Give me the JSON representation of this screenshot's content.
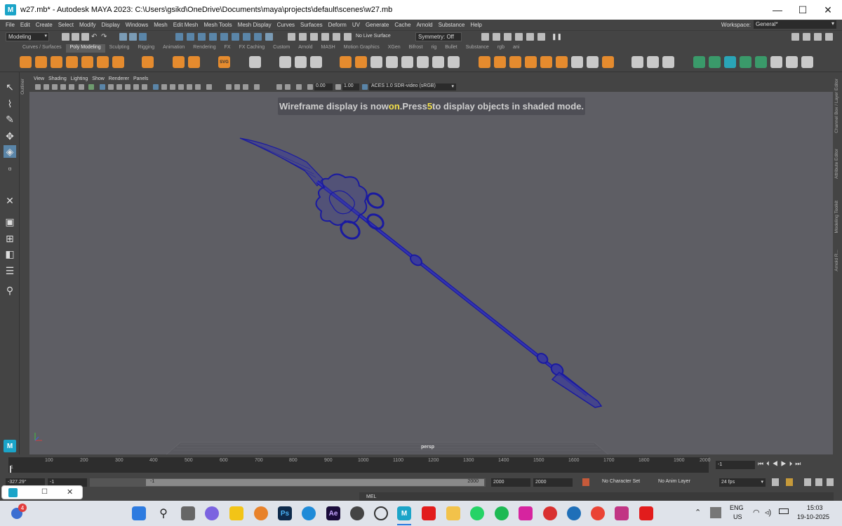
{
  "window": {
    "title": "w27.mb* - Autodesk MAYA 2023: C:\\Users\\gsikd\\OneDrive\\Documents\\maya\\projects\\default\\scenes\\w27.mb",
    "app_icon": "M",
    "minimize": "—",
    "maximize": "☐",
    "close": "✕"
  },
  "menubar": {
    "items": [
      "File",
      "Edit",
      "Create",
      "Select",
      "Modify",
      "Display",
      "Windows",
      "Mesh",
      "Edit Mesh",
      "Mesh Tools",
      "Mesh Display",
      "Curves",
      "Surfaces",
      "Deform",
      "UV",
      "Generate",
      "Cache",
      "Arnold",
      "Substance",
      "Help"
    ],
    "workspace_label": "Workspace:",
    "workspace_value": "General*"
  },
  "statusline": {
    "mode": "Modeling",
    "live_surface": "No Live Surface",
    "symmetry": "Symmetry: Off"
  },
  "shelf": {
    "tabs": [
      "Curves / Surfaces",
      "Poly Modeling",
      "Sculpting",
      "Rigging",
      "Animation",
      "Rendering",
      "FX",
      "FX Caching",
      "Custom",
      "Arnold",
      "MASH",
      "Motion Graphics",
      "XGen",
      "Bifrost",
      "rig",
      "Bullet",
      "Substance",
      "rgb",
      "ani"
    ],
    "active_tab": "Poly Modeling",
    "text_icon": "T",
    "svg_icon": "SVG"
  },
  "panel": {
    "menus": [
      "View",
      "Shading",
      "Lighting",
      "Show",
      "Renderer",
      "Panels"
    ],
    "exposure": "0.00",
    "gamma": "1.00",
    "color_space": "ACES 1.0 SDR-video (sRGB)",
    "camera_label": "persp",
    "outliner_label": "Outliner"
  },
  "hud": {
    "msg_before": "Wireframe display is now ",
    "msg_on": "on",
    "msg_mid": ".Press ",
    "msg_key": "5",
    "msg_after": " to display objects in shaded mode."
  },
  "right_tabs": [
    "Channel Box / Layer Editor",
    "Attribute Editor",
    "Modeling Toolkit",
    "Arnold R..."
  ],
  "timeline": {
    "ticks": [
      "1",
      "100",
      "200",
      "300",
      "400",
      "500",
      "600",
      "700",
      "800",
      "900",
      "1000",
      "1100",
      "1200",
      "1300",
      "1400",
      "1500",
      "1600",
      "1700",
      "1800",
      "1900",
      "2000"
    ],
    "current_frame": "1",
    "range_start_outer": "-1",
    "range_start_inner": "-1",
    "range_end_inner": "2000",
    "range_end_a": "2000",
    "range_end_b": "2000",
    "character_set": "No Character Set",
    "anim_layer": "No Anim Layer",
    "fps": "24 fps",
    "coords": "-327.29°",
    "cmd_lang": "MEL"
  },
  "taskbar": {
    "badge": "4",
    "lang_top": "ENG",
    "lang_bottom": "US",
    "time": "15:03",
    "date": "19-10-2025"
  },
  "colors": {
    "viewport_bg": "#5e5e64",
    "wireframe": "#1a1aa0",
    "hud_highlight": "#f3e04a",
    "accent_blue": "#5a85a8"
  }
}
